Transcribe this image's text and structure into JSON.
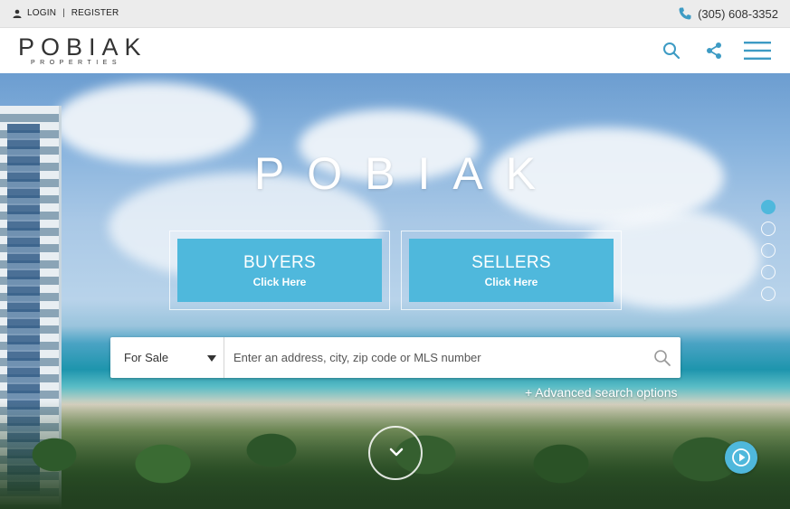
{
  "topbar": {
    "login_label": "LOGIN",
    "separator": "|",
    "register_label": "REGISTER",
    "phone": "(305) 608-3352"
  },
  "header": {
    "logo_main": "POBIAK",
    "logo_sub": "PROPERTIES"
  },
  "hero": {
    "title": "POBIAK",
    "buyers": {
      "title": "BUYERS",
      "subtitle": "Click Here"
    },
    "sellers": {
      "title": "SELLERS",
      "subtitle": "Click Here"
    },
    "slides": {
      "count": 5,
      "active": 1
    }
  },
  "search": {
    "type_selected": "For Sale",
    "placeholder": "Enter an address, city, zip code or MLS number",
    "advanced_label": "+ Advanced search options"
  },
  "colors": {
    "accent": "#4fb8dc",
    "icon_blue": "#3d9bc4"
  },
  "icons": [
    "user-icon",
    "phone-icon",
    "search-icon",
    "share-icon",
    "menu-icon",
    "chevron-down-icon",
    "play-icon"
  ]
}
